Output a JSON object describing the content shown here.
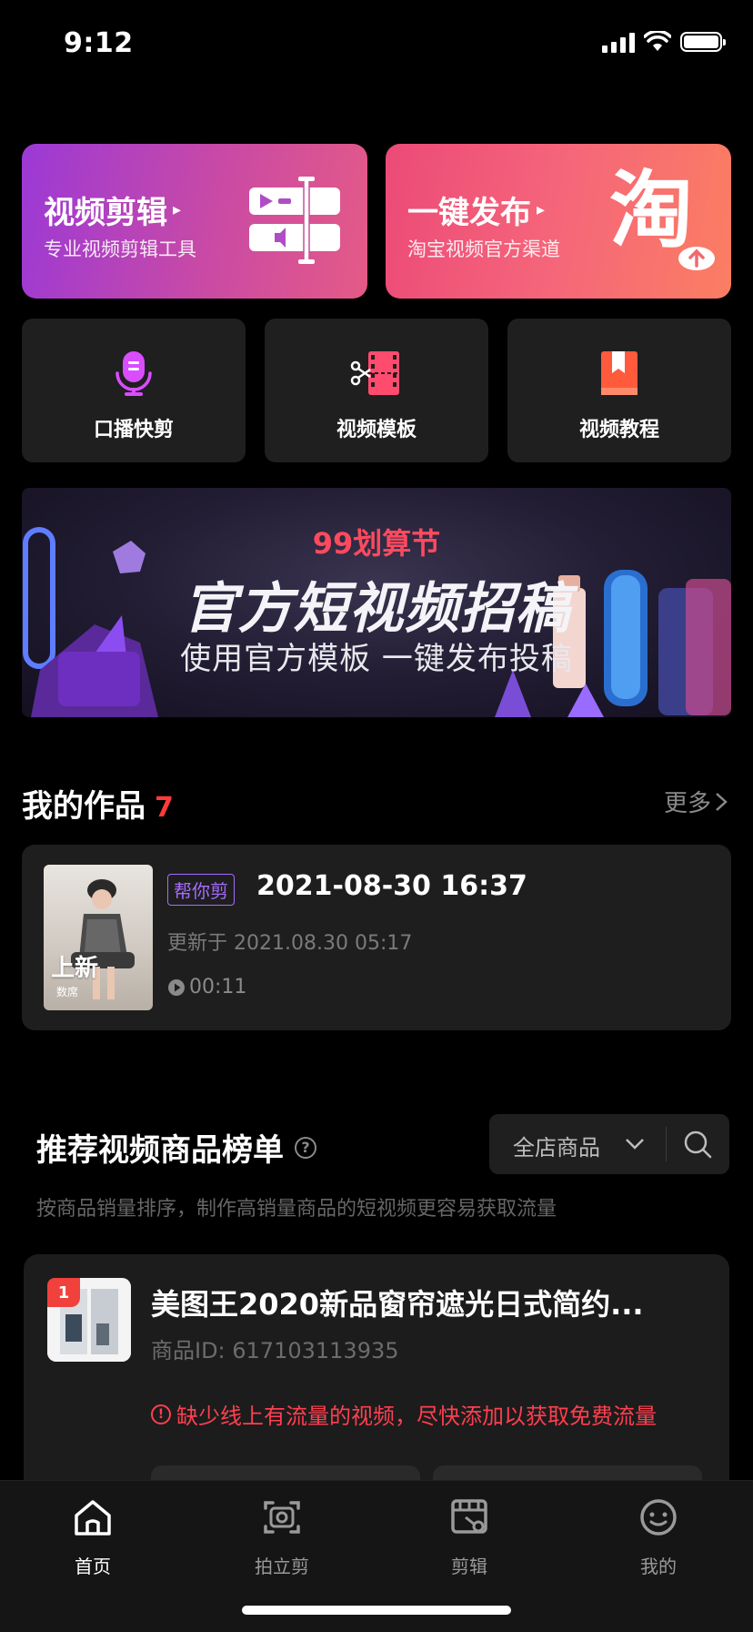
{
  "status_bar": {
    "time": "9:12"
  },
  "feature_cards": [
    {
      "title": "视频剪辑",
      "subtitle": "专业视频剪辑工具"
    },
    {
      "title": "一键发布",
      "subtitle": "淘宝视频官方渠道",
      "logo_text": "淘"
    }
  ],
  "tools": [
    {
      "label": "口播快剪",
      "icon": "microphone-icon"
    },
    {
      "label": "视频模板",
      "icon": "film-scissors-icon"
    },
    {
      "label": "视频教程",
      "icon": "bookmark-book-icon"
    }
  ],
  "banner": {
    "tag": "99划算节",
    "title": "官方短视频招稿",
    "subtitle": "使用官方模板 一键发布投稿"
  },
  "my_works": {
    "title": "我的作品",
    "count": "7",
    "more_label": "更多",
    "items": [
      {
        "tag": "帮你剪",
        "title": "2021-08-30 16:37",
        "updated": "更新于 2021.08.30 05:17",
        "duration": "00:11",
        "thumb_text": "上新",
        "thumb_text2": "数席"
      }
    ]
  },
  "ranking": {
    "title": "推荐视频商品榜单",
    "filter_label": "全店商品",
    "description": "按商品销量排序，制作高销量商品的短视频更容易获取流量",
    "products": [
      {
        "rank": "1",
        "name": "美图王2020新品窗帘遮光日式简约...",
        "id": "商品ID: 617103113935",
        "warning": "缺少线上有流量的视频，尽快添加以获取免费流量"
      }
    ]
  },
  "tab_bar": [
    {
      "label": "首页",
      "icon": "home-icon",
      "active": true
    },
    {
      "label": "拍立剪",
      "icon": "camera-icon",
      "active": false
    },
    {
      "label": "剪辑",
      "icon": "edit-clip-icon",
      "active": false
    },
    {
      "label": "我的",
      "icon": "smiley-profile-icon",
      "active": false
    }
  ],
  "colors": {
    "accent_red": "#ff3b3b",
    "accent_purple": "#a56cff",
    "edit_card_gradient": [
      "#9b39d6",
      "#e55a86"
    ],
    "publish_card_gradient": [
      "#ec4a78",
      "#fb7e62"
    ]
  }
}
